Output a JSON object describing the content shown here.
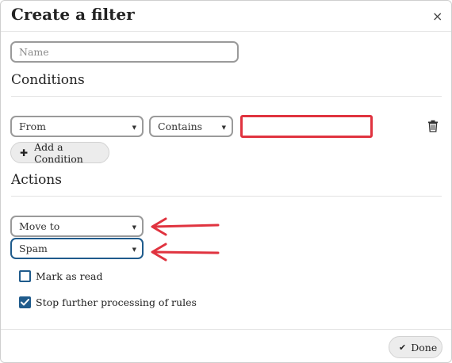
{
  "dialog": {
    "title": "Create a filter",
    "close_glyph": "×"
  },
  "name_field": {
    "placeholder": "Name"
  },
  "conditions": {
    "heading": "Conditions",
    "field_select": "From",
    "operator_select": "Contains",
    "value": "",
    "delete_icon": "trash-icon",
    "add_button": {
      "icon": "plus-icon",
      "glyph": "✚",
      "label": "Add a Condition"
    }
  },
  "actions": {
    "heading": "Actions",
    "action_select": "Move to",
    "folder_select": "Spam",
    "mark_as_read": {
      "label": "Mark as read",
      "checked": false
    },
    "stop_processing": {
      "label": "Stop further processing of rules",
      "checked": true
    }
  },
  "footer": {
    "done_button": {
      "icon": "checkmark-icon",
      "glyph": "✔",
      "label": "Done"
    }
  },
  "colors": {
    "annotation_red": "#e0333f",
    "focus_blue": "#1f5b8c",
    "checkbox_blue": "#1f5b8c"
  }
}
